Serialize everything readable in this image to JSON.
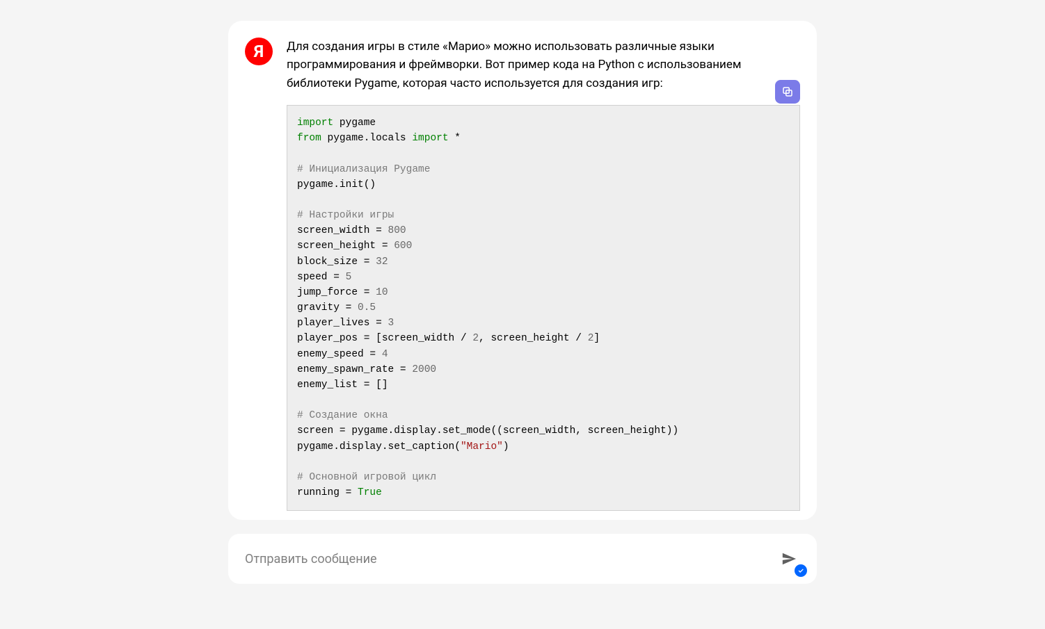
{
  "message": {
    "avatar_letter": "Я",
    "intro": "Для создания игры в стиле «Марио» можно использовать различные языки программирования и фреймворки. Вот пример кода на Python с использованием библиотеки Pygame, которая часто используется для создания игр:"
  },
  "code": {
    "lines": [
      {
        "t": [
          [
            "kw",
            "import"
          ],
          [
            "",
            " pygame"
          ]
        ]
      },
      {
        "t": [
          [
            "kw",
            "from"
          ],
          [
            "",
            " pygame.locals "
          ],
          [
            "kw",
            "import"
          ],
          [
            "",
            " *"
          ]
        ]
      },
      {
        "t": [
          [
            "",
            ""
          ]
        ]
      },
      {
        "t": [
          [
            "cm",
            "# Инициализация Pygame"
          ]
        ]
      },
      {
        "t": [
          [
            "",
            "pygame.init()"
          ]
        ]
      },
      {
        "t": [
          [
            "",
            ""
          ]
        ]
      },
      {
        "t": [
          [
            "cm",
            "# Настройки игры"
          ]
        ]
      },
      {
        "t": [
          [
            "",
            "screen_width = "
          ],
          [
            "num",
            "800"
          ]
        ]
      },
      {
        "t": [
          [
            "",
            "screen_height = "
          ],
          [
            "num",
            "600"
          ]
        ]
      },
      {
        "t": [
          [
            "",
            "block_size = "
          ],
          [
            "num",
            "32"
          ]
        ]
      },
      {
        "t": [
          [
            "",
            "speed = "
          ],
          [
            "num",
            "5"
          ]
        ]
      },
      {
        "t": [
          [
            "",
            "jump_force = "
          ],
          [
            "num",
            "10"
          ]
        ]
      },
      {
        "t": [
          [
            "",
            "gravity = "
          ],
          [
            "num",
            "0.5"
          ]
        ]
      },
      {
        "t": [
          [
            "",
            "player_lives = "
          ],
          [
            "num",
            "3"
          ]
        ]
      },
      {
        "t": [
          [
            "",
            "player_pos = [screen_width / "
          ],
          [
            "num",
            "2"
          ],
          [
            "",
            ", screen_height / "
          ],
          [
            "num",
            "2"
          ],
          [
            "",
            "]"
          ]
        ]
      },
      {
        "t": [
          [
            "",
            "enemy_speed = "
          ],
          [
            "num",
            "4"
          ]
        ]
      },
      {
        "t": [
          [
            "",
            "enemy_spawn_rate = "
          ],
          [
            "num",
            "2000"
          ]
        ]
      },
      {
        "t": [
          [
            "",
            "enemy_list = []"
          ]
        ]
      },
      {
        "t": [
          [
            "",
            ""
          ]
        ]
      },
      {
        "t": [
          [
            "cm",
            "# Создание окна"
          ]
        ]
      },
      {
        "t": [
          [
            "",
            "screen = pygame.display.set_mode((screen_width, screen_height))"
          ]
        ]
      },
      {
        "t": [
          [
            "",
            "pygame.display.set_caption("
          ],
          [
            "str",
            "\"Mario\""
          ],
          [
            "",
            ")"
          ]
        ]
      },
      {
        "t": [
          [
            "",
            ""
          ]
        ]
      },
      {
        "t": [
          [
            "cm",
            "# Основной игровой цикл"
          ]
        ]
      },
      {
        "t": [
          [
            "",
            "running = "
          ],
          [
            "kw",
            "True"
          ]
        ]
      }
    ]
  },
  "input": {
    "placeholder": "Отправить сообщение"
  }
}
